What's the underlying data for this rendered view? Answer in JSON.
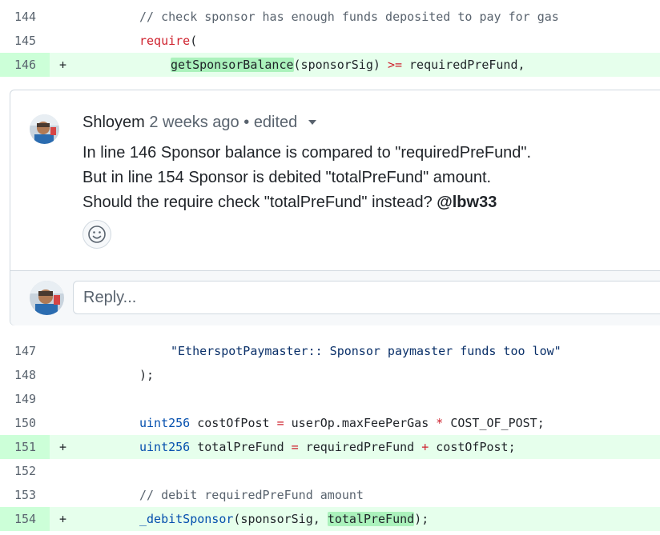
{
  "diff_top": [
    {
      "num": "144",
      "sign": "",
      "added": false,
      "indent": 174,
      "tokens": [
        {
          "t": "// check sponsor has enough funds deposited to pay for gas",
          "c": "cm"
        }
      ]
    },
    {
      "num": "145",
      "sign": "",
      "added": false,
      "indent": 174,
      "tokens": [
        {
          "t": "require",
          "c": "kw"
        },
        {
          "t": "(",
          "c": ""
        }
      ]
    },
    {
      "num": "146",
      "sign": "+",
      "added": true,
      "indent": 213,
      "tokens": [
        {
          "t": "getSponsorBalance",
          "c": "hl"
        },
        {
          "t": "(sponsorSig) ",
          "c": ""
        },
        {
          "t": ">=",
          "c": "op"
        },
        {
          "t": " requiredPreFund,",
          "c": ""
        }
      ]
    }
  ],
  "comment": {
    "author": "Shloyem",
    "time": "2 weeks ago",
    "separator": "•",
    "edited": "edited",
    "lines": [
      "In line 146 Sponsor balance is compared to \"requiredPreFund\".",
      "But in line 154 Sponsor is debited \"totalPreFund\" amount.",
      "Should the require check \"totalPreFund\" instead? "
    ],
    "mention": "@lbw33",
    "emoji_icon": "smiley-icon",
    "reply_placeholder": "Reply..."
  },
  "diff_bottom": [
    {
      "num": "147",
      "sign": "",
      "added": false,
      "indent": 213,
      "tokens": [
        {
          "t": "\"EtherspotPaymaster:: Sponsor paymaster funds too low\"",
          "c": "st"
        }
      ]
    },
    {
      "num": "148",
      "sign": "",
      "added": false,
      "indent": 174,
      "tokens": [
        {
          "t": ");",
          "c": ""
        }
      ]
    },
    {
      "num": "149",
      "sign": "",
      "added": false,
      "indent": 174,
      "tokens": []
    },
    {
      "num": "150",
      "sign": "",
      "added": false,
      "indent": 174,
      "tokens": [
        {
          "t": "uint256",
          "c": "ty"
        },
        {
          "t": " costOfPost ",
          "c": ""
        },
        {
          "t": "=",
          "c": "op"
        },
        {
          "t": " userOp.maxFeePerGas ",
          "c": ""
        },
        {
          "t": "*",
          "c": "op"
        },
        {
          "t": " COST_OF_POST;",
          "c": ""
        }
      ]
    },
    {
      "num": "151",
      "sign": "+",
      "added": true,
      "indent": 174,
      "tokens": [
        {
          "t": "uint256",
          "c": "ty"
        },
        {
          "t": " totalPreFund ",
          "c": ""
        },
        {
          "t": "=",
          "c": "op"
        },
        {
          "t": " requiredPreFund ",
          "c": ""
        },
        {
          "t": "+",
          "c": "op"
        },
        {
          "t": " costOfPost;",
          "c": ""
        }
      ]
    },
    {
      "num": "152",
      "sign": "",
      "added": false,
      "indent": 174,
      "tokens": []
    },
    {
      "num": "153",
      "sign": "",
      "added": false,
      "indent": 174,
      "tokens": [
        {
          "t": "// debit requiredPreFund amount",
          "c": "cm"
        }
      ]
    },
    {
      "num": "154",
      "sign": "+",
      "added": true,
      "indent": 174,
      "tokens": [
        {
          "t": "_debitSponsor",
          "c": "ty"
        },
        {
          "t": "(sponsorSig, ",
          "c": ""
        },
        {
          "t": "totalPreFund",
          "c": "hl"
        },
        {
          "t": ");",
          "c": ""
        }
      ]
    }
  ]
}
